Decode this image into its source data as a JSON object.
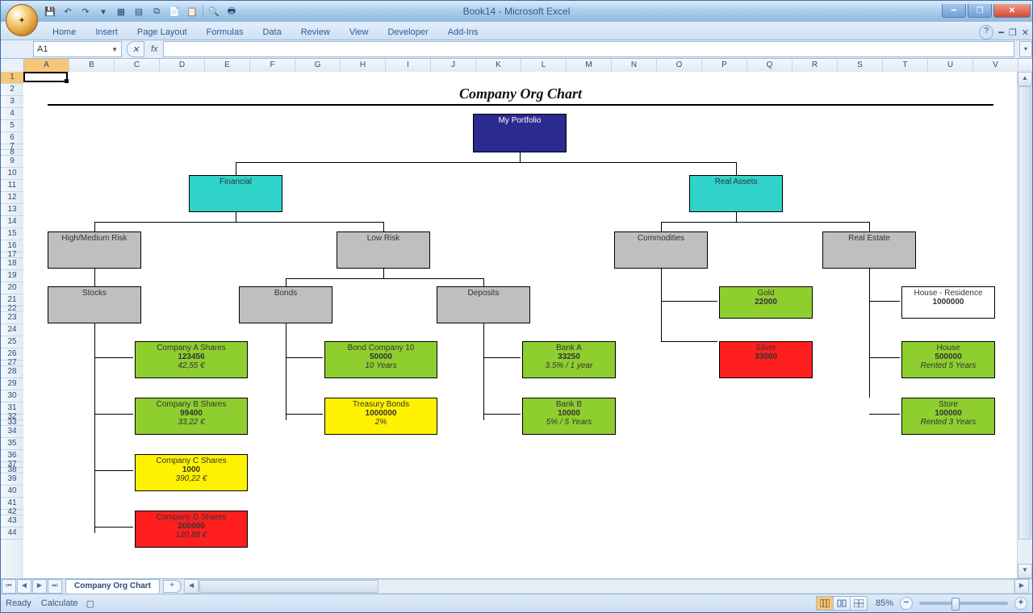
{
  "window": {
    "title": "Book14 - Microsoft Excel"
  },
  "qat_icons": [
    "save-icon",
    "undo-icon",
    "redo-icon",
    "qat-dropdown-icon",
    "table-icon",
    "grid-icon",
    "copy-icon",
    "new-sheet-icon",
    "paste-icon",
    "sep",
    "find-icon",
    "print-icon"
  ],
  "ribbon_tabs": [
    "Home",
    "Insert",
    "Page Layout",
    "Formulas",
    "Data",
    "Review",
    "View",
    "Developer",
    "Add-Ins"
  ],
  "namebox": "A1",
  "fx_label": "fx",
  "columns": [
    "A",
    "B",
    "C",
    "D",
    "E",
    "F",
    "G",
    "H",
    "I",
    "J",
    "K",
    "L",
    "M",
    "N",
    "O",
    "P",
    "Q",
    "R",
    "S",
    "T",
    "U",
    "V"
  ],
  "rows": [
    1,
    2,
    3,
    4,
    5,
    6,
    7,
    8,
    9,
    10,
    11,
    12,
    13,
    14,
    15,
    16,
    17,
    18,
    19,
    20,
    21,
    22,
    23,
    24,
    25,
    26,
    27,
    28,
    29,
    30,
    31,
    32,
    33,
    34,
    35,
    36,
    37,
    38,
    39,
    40,
    41,
    42,
    43,
    44
  ],
  "chart": {
    "title": "Company Org Chart",
    "nodes": {
      "root": {
        "label": "My Portfolio"
      },
      "financial": {
        "label": "Financial"
      },
      "real": {
        "label": "Real Assets"
      },
      "hmrisk": {
        "label": "High/Medium Risk"
      },
      "lowrisk": {
        "label": "Low Risk"
      },
      "commod": {
        "label": "Commodities"
      },
      "restate": {
        "label": "Real Estate"
      },
      "stocks": {
        "label": "Stocks"
      },
      "bonds": {
        "label": "Bonds"
      },
      "deposits": {
        "label": "Deposits"
      },
      "gold": {
        "label": "Gold",
        "val": "22000"
      },
      "houseRes": {
        "label": "House - Residence",
        "val": "1000000"
      },
      "coA": {
        "label": "Company A Shares",
        "val": "123456",
        "sub": "42,55 €"
      },
      "coB": {
        "label": "Company B Shares",
        "val": "99400",
        "sub": "33,22 €"
      },
      "coC": {
        "label": "Company C Shares",
        "val": "1000",
        "sub": "390,22 €"
      },
      "coD": {
        "label": "Company D Shares",
        "val": "200000",
        "sub": "120,88 €"
      },
      "bond10": {
        "label": "Bond Company 10",
        "val": "50000",
        "sub": "10 Years"
      },
      "tbonds": {
        "label": "Treasury Bonds",
        "val": "1000000",
        "sub": "2%"
      },
      "bankA": {
        "label": "Bank A",
        "val": "33250",
        "sub": "3.5% / 1 year"
      },
      "bankB": {
        "label": "Bank B",
        "val": "10000",
        "sub": "5% / 5 Years"
      },
      "silver": {
        "label": "Silver",
        "val": "33000"
      },
      "house": {
        "label": "House",
        "val": "500000",
        "sub": "Rented 5 Years"
      },
      "store": {
        "label": "Store",
        "val": "100000",
        "sub": "Rented 3 Years"
      }
    }
  },
  "sheet_tab": "Company Org Chart",
  "status": {
    "ready": "Ready",
    "calc": "Calculate",
    "zoom": "85%"
  }
}
